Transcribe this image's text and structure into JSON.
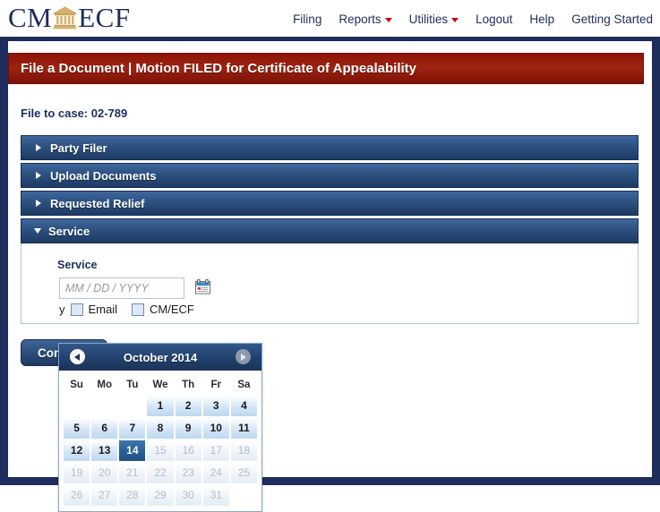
{
  "brand": {
    "text_left": "CM",
    "text_right": "ECF",
    "icon": "courthouse-icon"
  },
  "topnav": {
    "items": [
      {
        "label": "Filing",
        "has_dropdown": false
      },
      {
        "label": "Reports",
        "has_dropdown": true
      },
      {
        "label": "Utilities",
        "has_dropdown": true
      },
      {
        "label": "Logout",
        "has_dropdown": false
      },
      {
        "label": "Help",
        "has_dropdown": false
      },
      {
        "label": "Getting Started",
        "has_dropdown": false
      }
    ]
  },
  "page": {
    "title": "File a Document | Motion FILED for Certificate of Appealability",
    "case_line": "File to case: 02-789",
    "continue_label": "Continue"
  },
  "accordion": {
    "sections": [
      {
        "label": "Party Filer",
        "expanded": false
      },
      {
        "label": "Upload Documents",
        "expanded": false
      },
      {
        "label": "Requested Relief",
        "expanded": false
      },
      {
        "label": "Service",
        "expanded": true
      }
    ]
  },
  "service": {
    "heading": "Service",
    "date_value": "",
    "date_placeholder": "MM / DD / YYYY",
    "calendar_icon": "calendar-icon",
    "trailing_text": "y",
    "checkboxes": [
      {
        "label": "Email",
        "checked": false
      },
      {
        "label": "CM/ECF",
        "checked": false
      }
    ]
  },
  "datepicker": {
    "title": "October 2014",
    "prev_label": "prev-month",
    "next_label": "next-month",
    "weekdays": [
      "Su",
      "Mo",
      "Tu",
      "We",
      "Th",
      "Fr",
      "Sa"
    ],
    "selected_day": 14,
    "weeks": [
      [
        {
          "day": "",
          "state": "blank"
        },
        {
          "day": "",
          "state": "blank"
        },
        {
          "day": "",
          "state": "blank"
        },
        {
          "day": "1",
          "state": "enabled"
        },
        {
          "day": "2",
          "state": "enabled"
        },
        {
          "day": "3",
          "state": "enabled"
        },
        {
          "day": "4",
          "state": "enabled"
        }
      ],
      [
        {
          "day": "5",
          "state": "enabled"
        },
        {
          "day": "6",
          "state": "enabled"
        },
        {
          "day": "7",
          "state": "enabled"
        },
        {
          "day": "8",
          "state": "enabled"
        },
        {
          "day": "9",
          "state": "enabled"
        },
        {
          "day": "10",
          "state": "enabled"
        },
        {
          "day": "11",
          "state": "enabled"
        }
      ],
      [
        {
          "day": "12",
          "state": "enabled"
        },
        {
          "day": "13",
          "state": "enabled"
        },
        {
          "day": "14",
          "state": "selected"
        },
        {
          "day": "15",
          "state": "disabled"
        },
        {
          "day": "16",
          "state": "disabled"
        },
        {
          "day": "17",
          "state": "disabled"
        },
        {
          "day": "18",
          "state": "disabled"
        }
      ],
      [
        {
          "day": "19",
          "state": "disabled"
        },
        {
          "day": "20",
          "state": "disabled"
        },
        {
          "day": "21",
          "state": "disabled"
        },
        {
          "day": "22",
          "state": "disabled"
        },
        {
          "day": "23",
          "state": "disabled"
        },
        {
          "day": "24",
          "state": "disabled"
        },
        {
          "day": "25",
          "state": "disabled"
        }
      ],
      [
        {
          "day": "26",
          "state": "disabled"
        },
        {
          "day": "27",
          "state": "disabled"
        },
        {
          "day": "28",
          "state": "disabled"
        },
        {
          "day": "29",
          "state": "disabled"
        },
        {
          "day": "30",
          "state": "disabled"
        },
        {
          "day": "31",
          "state": "disabled"
        },
        {
          "day": "",
          "state": "blank"
        }
      ]
    ]
  },
  "colors": {
    "navy": "#1d2d5c",
    "red_title": "#9e2310",
    "accordion_blue": "#2c517f",
    "accent_red": "#cc0000",
    "selected_day": "#2a5e96"
  }
}
